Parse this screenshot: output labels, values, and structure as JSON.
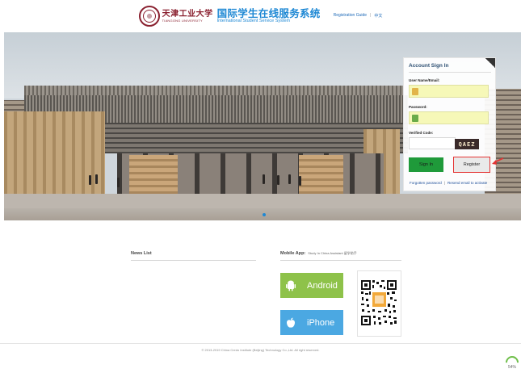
{
  "header": {
    "university_cn": "天津工业大学",
    "university_en": "TIANGONG UNIVERSITY",
    "system_cn": "国际学生在线服务系统",
    "system_en": "International Student Service System",
    "registration_guide": "Registration Guide",
    "language": "中文"
  },
  "signin": {
    "title": "Account Sign In",
    "username_label": "User Name/Email:",
    "password_label": "Password:",
    "code_label": "Verified Code:",
    "captcha": "QAEZ",
    "sign_in": "Sign In",
    "register": "Register",
    "forgotten_password": "Forgotten password",
    "resend_email": "Resend email to activate"
  },
  "news": {
    "title": "News List"
  },
  "mobile": {
    "title": "Mobile App:",
    "subtitle": "Study In China Assistant 留学助手",
    "android": "Android",
    "iphone": "iPhone"
  },
  "footer": {
    "copyright": "© 2013-2019 China Credo Institute (Beijing) Technology Co.,Ltd. All right reserved."
  },
  "badge": {
    "value": "54%"
  },
  "colors": {
    "brand_blue": "#1e88d4",
    "university_red": "#8a2130",
    "signin_green": "#1f9a3a",
    "android_green": "#8ec24a",
    "iphone_blue": "#4ba8e2",
    "highlight_red": "#e43333"
  }
}
